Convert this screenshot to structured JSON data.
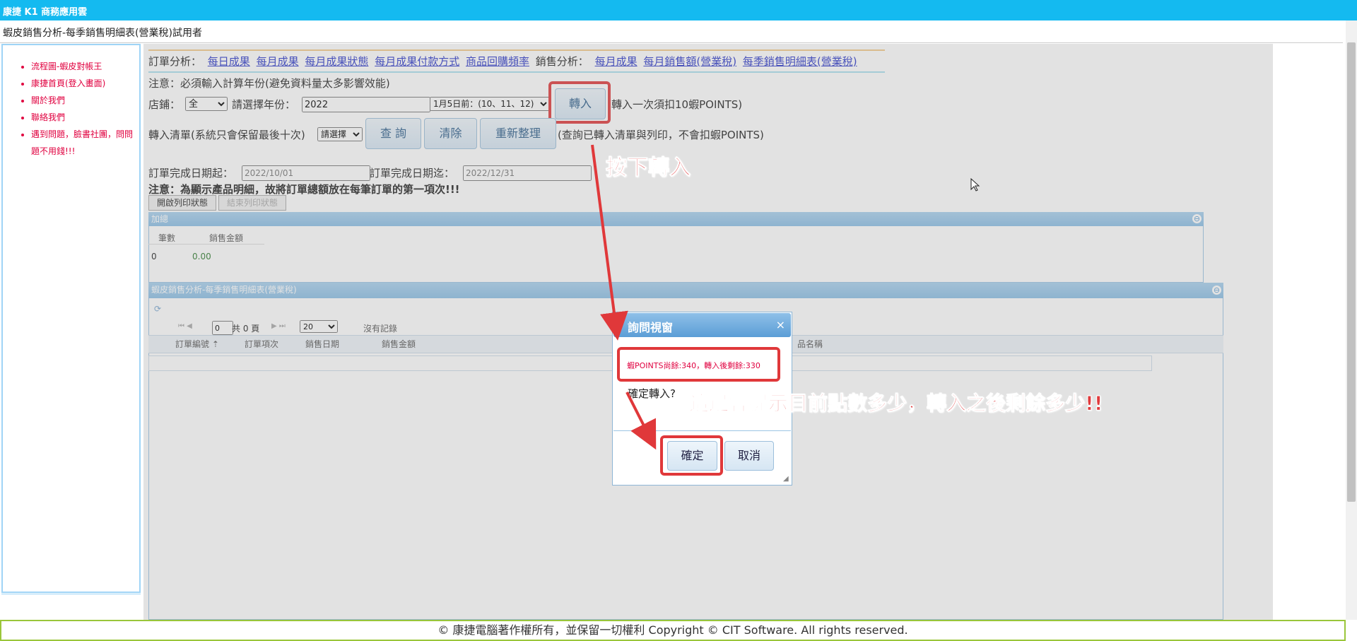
{
  "app": {
    "title": "康捷 K1 商務應用雲"
  },
  "page": {
    "title": "蝦皮銷售分析-每季銷售明細表(營業稅)試用者"
  },
  "sidebar": {
    "items": [
      {
        "label": "流程圖-蝦皮對帳王"
      },
      {
        "label": "康捷首頁(登入畫面)"
      },
      {
        "label": "關於我們"
      },
      {
        "label": "聯絡我們"
      },
      {
        "label": "遇到問題，臉書社團，問問題不用錢!!!"
      }
    ]
  },
  "nav": {
    "order_label": "訂單分析：",
    "order_links": [
      "每日成果",
      "每月成果",
      "每月成果狀態",
      "每月成果付款方式",
      "商品回購頻率"
    ],
    "sales_label": "銷售分析：",
    "sales_links": [
      "每月成果",
      "每月銷售額(營業稅)",
      "每季銷售明細表(營業稅)"
    ]
  },
  "form": {
    "notice": "注意：必須輸入計算年份(避免資料量太多影響效能)",
    "store_label": "店鋪：",
    "store_value": "全",
    "year_label": "請選擇年份：",
    "year_value": "2022",
    "quarter_value": "1月5日前：(10、11、12)",
    "import_button": "轉入",
    "import_note": "轉入一次須扣10蝦POINTS)",
    "list_label": "轉入清單(系統只會保留最後十次)",
    "list_select": "請選擇",
    "query_button": "查 詢",
    "clear_button": "清除",
    "reorganize_button": "重新整理",
    "query_note": "(查詢已轉入清單與列印，不會扣蝦POINTS)",
    "date_start_label": "訂單完成日期起：",
    "date_start_value": "2022/10/01",
    "date_end_label": "訂單完成日期迄：",
    "date_end_value": "2022/12/31",
    "notice2": "注意：為顯示產品明細，故將訂單總額放在每筆訂單的第一項次!!!",
    "print_start": "開啟列印狀態",
    "print_end": "結束列印狀態"
  },
  "sum_panel": {
    "title": "加總",
    "columns": [
      "筆數",
      "銷售金額"
    ],
    "row": [
      "0",
      "0.00"
    ]
  },
  "grid_panel": {
    "title": "蝦皮銷售分析-每季銷售明細表(營業稅)",
    "page_value": "0",
    "page_total": "共 0 頁",
    "page_size": "20",
    "empty_text": "沒有記錄",
    "columns": [
      "訂單編號",
      "訂單項次",
      "銷售日期",
      "銷售金額",
      "品名稱"
    ]
  },
  "dialog": {
    "title": "詢問視窗",
    "points_text": "蝦POINTS尚餘:340，轉入後剩餘:330",
    "question": "確定轉入?",
    "ok_button": "確定",
    "cancel_button": "取消"
  },
  "annotations": {
    "press_import": "按下轉入",
    "points_hint": "這邊會提示目前點數多少，轉入之後剩餘多少!!"
  },
  "footer": {
    "text": "© 康捷電腦著作權所有，並保留一切權利 Copyright © CIT Software. All rights reserved."
  },
  "colors": {
    "topbar": "#14baf0",
    "annotation": "#e0383a",
    "footer_border": "#9ac63a"
  }
}
